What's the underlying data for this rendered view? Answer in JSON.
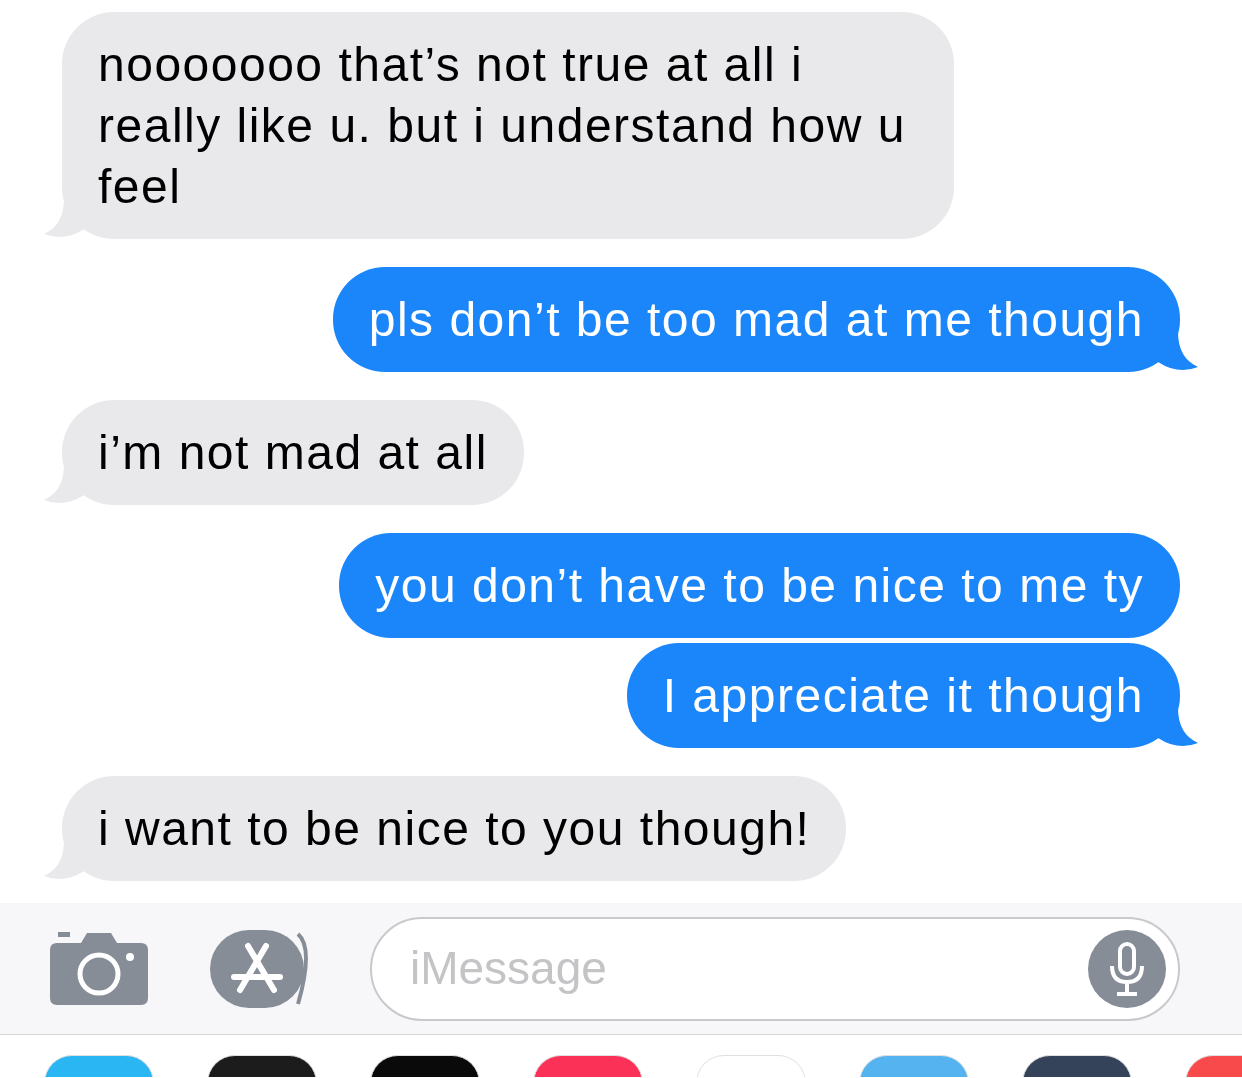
{
  "messages": [
    {
      "kind": "incoming",
      "text": "nooooooo that’s not true at all i really like u. but i understand how u feel",
      "tail": true
    },
    {
      "kind": "outgoing",
      "text": "pls don’t be too mad at me though",
      "tail": true
    },
    {
      "kind": "incoming",
      "text": "i’m not mad at all",
      "tail": true
    },
    {
      "kind": "outgoing",
      "text": "you don’t have to be nice to me ty",
      "tail": false
    },
    {
      "kind": "outgoing",
      "text": "I appreciate it though",
      "tail": true
    },
    {
      "kind": "incoming",
      "text": "i want to be nice to you though!",
      "tail": true
    }
  ],
  "input": {
    "placeholder": "iMessage"
  },
  "app_strip": [
    {
      "color": "#29b6f2"
    },
    {
      "color": "#1c1c1c"
    },
    {
      "color": "#0a0a0a"
    },
    {
      "color": "#fb3158"
    },
    {
      "color": "#ffffff"
    },
    {
      "color": "#55b4ef"
    },
    {
      "color": "#34425a"
    },
    {
      "color": "#f84a4a"
    }
  ]
}
